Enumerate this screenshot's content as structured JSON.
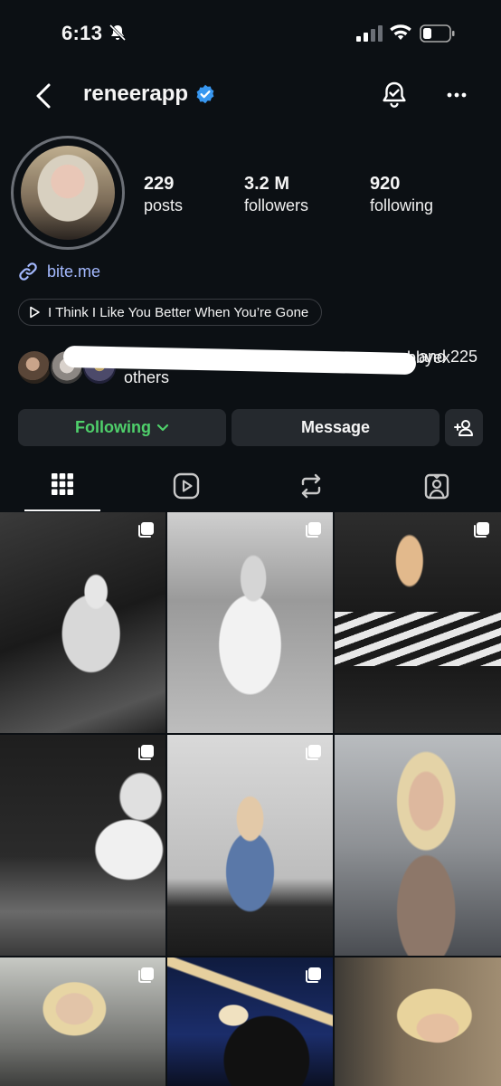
{
  "status_bar": {
    "time": "6:13"
  },
  "header": {
    "username": "reneerapp"
  },
  "stats": [
    {
      "value": "229",
      "label": "posts"
    },
    {
      "value": "3.2 M",
      "label": "followers"
    },
    {
      "value": "920",
      "label": "following"
    }
  ],
  "bio": {
    "link": "bite.me",
    "music": "I Think I Like You Better When You’re Gone"
  },
  "mutuals": {
    "visible_fragment": "abbyex",
    "tail": "and 225",
    "line2": "others"
  },
  "actions": {
    "following_label": "Following",
    "message_label": "Message"
  },
  "tabs": [
    {
      "name": "posts",
      "icon": "grid-icon",
      "active": true
    },
    {
      "name": "reels",
      "icon": "reels-icon",
      "active": false
    },
    {
      "name": "reposts",
      "icon": "repost-icon",
      "active": false
    },
    {
      "name": "tagged",
      "icon": "tagged-icon",
      "active": false
    }
  ],
  "colors": {
    "background": "#0c1014",
    "button": "#25292e",
    "following_green": "#4fd06b",
    "link_blue": "#a4b9ff",
    "verified_blue": "#3897f0"
  }
}
